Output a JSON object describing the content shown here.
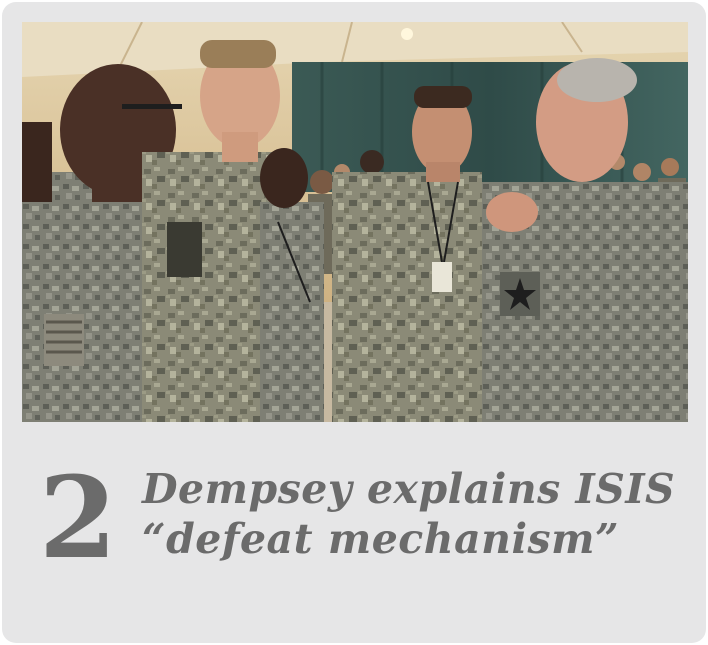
{
  "story": {
    "rank": "2",
    "headline_line1": "Dempsey explains ISIS",
    "headline_line2": "“defeat mechanism”"
  },
  "colors": {
    "card_background": "#e6e6e7",
    "text": "#6b6b6b"
  }
}
